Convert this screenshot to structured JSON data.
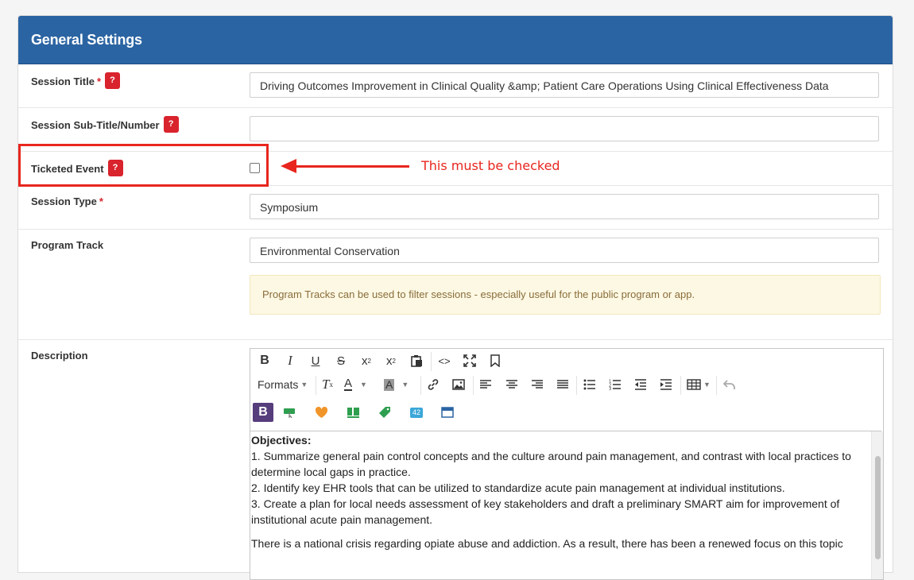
{
  "panel": {
    "title": "General Settings"
  },
  "fields": {
    "session_title": {
      "label": "Session Title",
      "required_mark": "*",
      "help": "?",
      "value": "Driving Outcomes Improvement in Clinical Quality &amp; Patient Care Operations Using Clinical Effectiveness Data"
    },
    "subtitle": {
      "label": "Session Sub-Title/Number",
      "help": "?",
      "value": ""
    },
    "ticketed": {
      "label": "Ticketed Event",
      "help": "?",
      "checked": false
    },
    "session_type": {
      "label": "Session Type",
      "required_mark": "*",
      "value": "Symposium"
    },
    "program_track": {
      "label": "Program Track",
      "value": "Environmental Conservation",
      "note": "Program Tracks can be used to filter sessions - especially useful for the public program or app."
    },
    "description": {
      "label": "Description"
    }
  },
  "annotation": {
    "text": "This must be checked",
    "color": "#e8261e"
  },
  "editor": {
    "formats_label": "Formats",
    "toolbar_icons": [
      "bold-icon",
      "italic-icon",
      "underline-icon",
      "strikethrough-icon",
      "superscript-icon",
      "subscript-icon",
      "paste-icon",
      "source-code-icon",
      "fullscreen-icon",
      "bookmark-icon",
      "clear-format-icon",
      "text-color-icon",
      "background-color-icon",
      "link-icon",
      "image-icon",
      "align-left-icon",
      "align-center-icon",
      "align-right-icon",
      "align-justify-icon",
      "bullet-list-icon",
      "numbered-list-icon",
      "outdent-icon",
      "indent-icon",
      "table-icon",
      "undo-icon"
    ],
    "plugin_icons": [
      "bootstrap-icon",
      "button-icon",
      "heart-icon",
      "layout-icon",
      "tag-icon",
      "badge-icon",
      "panel-icon"
    ],
    "badge_text": "42",
    "content": {
      "heading": "Objectives:",
      "lines": [
        "1. Summarize general pain control concepts and the culture around pain management, and contrast with local practices to determine local gaps in practice.",
        "2. Identify key EHR tools that can be utilized to standardize acute pain management at individual institutions.",
        "3. Create a plan for local needs assessment of key stakeholders and draft a preliminary SMART aim for improvement of institutional acute pain management."
      ],
      "paragraph": "There is a national crisis regarding opiate abuse and addiction. As a result, there has been a renewed focus on this topic"
    }
  },
  "colors": {
    "header": "#2b64a3",
    "required": "#d9232d",
    "alert_bg": "#fcf8e3",
    "alert_text": "#8a6d3b"
  }
}
